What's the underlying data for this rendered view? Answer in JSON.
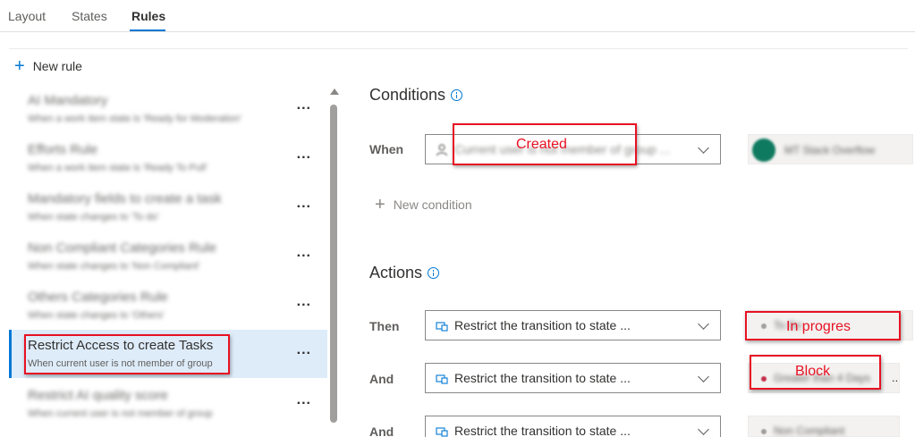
{
  "tabs": [
    {
      "label": "Layout"
    },
    {
      "label": "States"
    },
    {
      "label": "Rules"
    }
  ],
  "toolbar": {
    "new_rule_label": "New rule"
  },
  "rules": [
    {
      "title": "AI Mandatory",
      "subtitle": "When a work item state is 'Ready for Moderation'"
    },
    {
      "title": "Efforts Rule",
      "subtitle": "When a work item state is 'Ready To Pull'"
    },
    {
      "title": "Mandatory fields to create a task",
      "subtitle": "When state changes to 'To do'"
    },
    {
      "title": "Non Compliant Categories Rule",
      "subtitle": "When state changes to 'Non Compliant'"
    },
    {
      "title": "Others Categories Rule",
      "subtitle": "When state changes to 'Others'"
    },
    {
      "title": "Restrict Access to create Tasks",
      "subtitle": "When current user is not member of group"
    },
    {
      "title": "Restrict AI quality score",
      "subtitle": "When current user is not member of group"
    }
  ],
  "more_label": "...",
  "conditions": {
    "title": "Conditions",
    "when_label": "When",
    "condition_value": "Current user is not member of group ...",
    "group_value": "MT Stack Overflow",
    "group_avatar_initials": "MT",
    "new_condition_label": "New condition"
  },
  "actions": {
    "title": "Actions",
    "rows": [
      {
        "label": "Then",
        "value": "Restrict the transition to state ...",
        "target": "To Do",
        "dot_color": "#a19f9d"
      },
      {
        "label": "And",
        "value": "Restrict the transition to state ...",
        "target": "Greater than 4 Days",
        "dot_color": "#c4314b"
      },
      {
        "label": "And",
        "value": "Restrict the transition to state ...",
        "target": "Non Compliant",
        "dot_color": "#a19f9d"
      }
    ],
    "tail": ".."
  },
  "annotations": {
    "created": "Created",
    "in_progress": "In progres",
    "block": "Block"
  },
  "colors": {
    "accent": "#0078d4",
    "annotation": "#e81123",
    "selected_bg": "#deecf9"
  }
}
